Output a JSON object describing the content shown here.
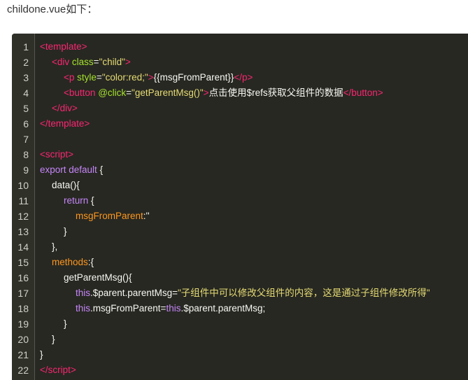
{
  "intro_text": "childone.vue如下：",
  "code": {
    "lines": [
      {
        "n": "1",
        "indent": 0,
        "tokens": [
          {
            "t": "<",
            "c": "tag"
          },
          {
            "t": "template",
            "c": "tag"
          },
          {
            "t": ">",
            "c": "tag"
          }
        ]
      },
      {
        "n": "2",
        "indent": 1,
        "tokens": [
          {
            "t": "<",
            "c": "tag"
          },
          {
            "t": "div",
            "c": "tag"
          },
          {
            "t": " class",
            "c": "attr"
          },
          {
            "t": "=",
            "c": "plain"
          },
          {
            "t": "\"child\"",
            "c": "str"
          },
          {
            "t": ">",
            "c": "tag"
          }
        ]
      },
      {
        "n": "3",
        "indent": 2,
        "tokens": [
          {
            "t": "<",
            "c": "tag"
          },
          {
            "t": "p",
            "c": "tag"
          },
          {
            "t": " style",
            "c": "attr"
          },
          {
            "t": "=",
            "c": "plain"
          },
          {
            "t": "\"color:red;\"",
            "c": "str"
          },
          {
            "t": ">",
            "c": "tag"
          },
          {
            "t": "{{msgFromParent}}",
            "c": "plain"
          },
          {
            "t": "</",
            "c": "tag"
          },
          {
            "t": "p",
            "c": "tag"
          },
          {
            "t": ">",
            "c": "tag"
          }
        ]
      },
      {
        "n": "4",
        "indent": 2,
        "tokens": [
          {
            "t": "<",
            "c": "tag"
          },
          {
            "t": "button",
            "c": "tag"
          },
          {
            "t": " @click",
            "c": "attr"
          },
          {
            "t": "=",
            "c": "plain"
          },
          {
            "t": "\"getParentMsg()\"",
            "c": "str"
          },
          {
            "t": ">",
            "c": "tag"
          },
          {
            "t": "点击使用$refs获取父组件的数据",
            "c": "plain"
          },
          {
            "t": "</",
            "c": "tag"
          },
          {
            "t": "button",
            "c": "tag"
          },
          {
            "t": ">",
            "c": "tag"
          }
        ]
      },
      {
        "n": "5",
        "indent": 1,
        "tokens": [
          {
            "t": "</",
            "c": "tag"
          },
          {
            "t": "div",
            "c": "tag"
          },
          {
            "t": ">",
            "c": "tag"
          }
        ]
      },
      {
        "n": "6",
        "indent": 0,
        "tokens": [
          {
            "t": "</",
            "c": "tag"
          },
          {
            "t": "template",
            "c": "tag"
          },
          {
            "t": ">",
            "c": "tag"
          }
        ]
      },
      {
        "n": "7",
        "indent": 0,
        "tokens": []
      },
      {
        "n": "8",
        "indent": 0,
        "tokens": [
          {
            "t": "<",
            "c": "tag"
          },
          {
            "t": "script",
            "c": "tag"
          },
          {
            "t": ">",
            "c": "tag"
          }
        ]
      },
      {
        "n": "9",
        "indent": 0,
        "tokens": [
          {
            "t": "export default",
            "c": "kw"
          },
          {
            "t": " {",
            "c": "plain"
          }
        ]
      },
      {
        "n": "10",
        "indent": 1,
        "tokens": [
          {
            "t": "data(){",
            "c": "plain"
          }
        ]
      },
      {
        "n": "11",
        "indent": 2,
        "tokens": [
          {
            "t": "return",
            "c": "kw"
          },
          {
            "t": " {",
            "c": "plain"
          }
        ]
      },
      {
        "n": "12",
        "indent": 3,
        "tokens": [
          {
            "t": "msgFromParent",
            "c": "prop"
          },
          {
            "t": ":''",
            "c": "plain"
          }
        ]
      },
      {
        "n": "13",
        "indent": 2,
        "tokens": [
          {
            "t": "}",
            "c": "plain"
          }
        ]
      },
      {
        "n": "14",
        "indent": 1,
        "tokens": [
          {
            "t": "},",
            "c": "plain"
          }
        ]
      },
      {
        "n": "15",
        "indent": 1,
        "tokens": [
          {
            "t": "methods",
            "c": "prop"
          },
          {
            "t": ":{",
            "c": "plain"
          }
        ]
      },
      {
        "n": "16",
        "indent": 2,
        "tokens": [
          {
            "t": "getParentMsg(){",
            "c": "plain"
          }
        ]
      },
      {
        "n": "17",
        "indent": 3,
        "tokens": [
          {
            "t": "this",
            "c": "kw"
          },
          {
            "t": ".$parent.parentMsg=",
            "c": "plain"
          },
          {
            "t": "\"子组件中可以修改父组件的内容，这是通过子组件修改所得\"",
            "c": "str"
          }
        ]
      },
      {
        "n": "18",
        "indent": 3,
        "tokens": [
          {
            "t": "this",
            "c": "kw"
          },
          {
            "t": ".msgFromParent=",
            "c": "plain"
          },
          {
            "t": "this",
            "c": "kw"
          },
          {
            "t": ".$parent.parentMsg;",
            "c": "plain"
          }
        ]
      },
      {
        "n": "19",
        "indent": 2,
        "tokens": [
          {
            "t": "}",
            "c": "plain"
          }
        ]
      },
      {
        "n": "20",
        "indent": 1,
        "tokens": [
          {
            "t": "}",
            "c": "plain"
          }
        ]
      },
      {
        "n": "21",
        "indent": 0,
        "tokens": [
          {
            "t": "}",
            "c": "plain"
          }
        ]
      },
      {
        "n": "22",
        "indent": 0,
        "tokens": [
          {
            "t": "</",
            "c": "tag"
          },
          {
            "t": "script",
            "c": "tag"
          },
          {
            "t": ">",
            "c": "tag"
          }
        ]
      }
    ]
  }
}
